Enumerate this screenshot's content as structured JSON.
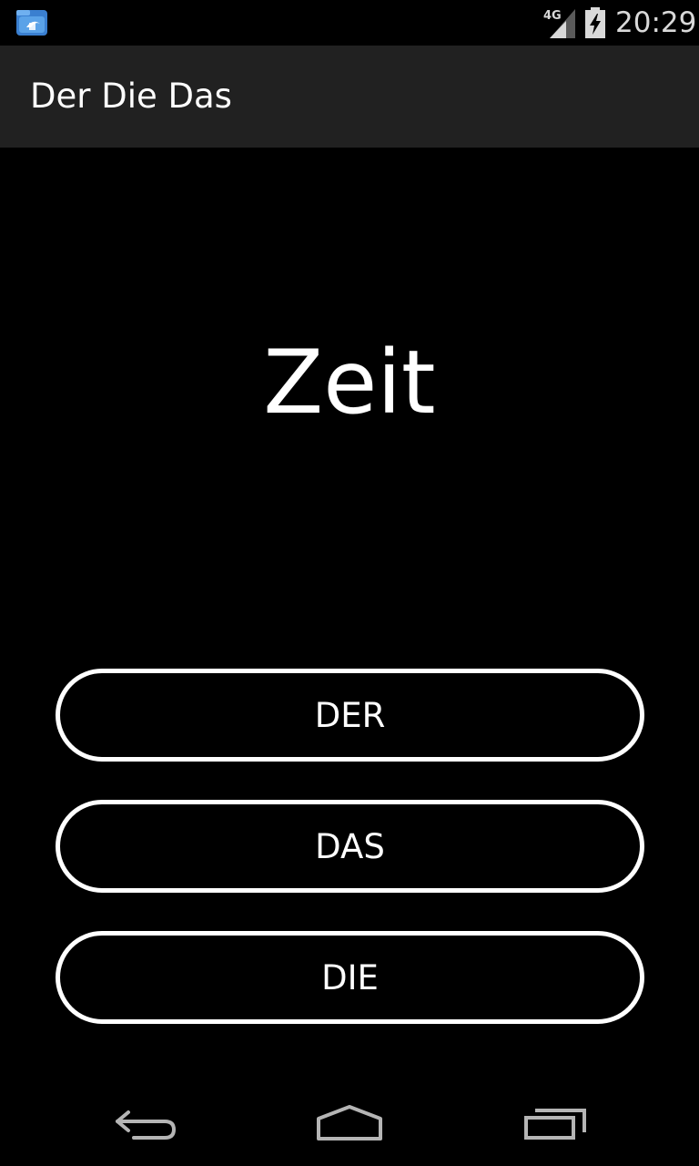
{
  "status_bar": {
    "time": "20:29",
    "network": "4G",
    "notification_icon": "file-manager-app-icon",
    "signal_icon": "signal-icon",
    "battery_icon": "battery-charging-icon"
  },
  "action_bar": {
    "title": "Der Die Das"
  },
  "quiz": {
    "word": "Zeit",
    "choices": [
      "DER",
      "DAS",
      "DIE"
    ]
  },
  "nav_bar": {
    "back_icon": "back-icon",
    "home_icon": "home-icon",
    "recents_icon": "recents-icon"
  },
  "colors": {
    "background": "#000000",
    "action_bar": "#212121",
    "text": "#ffffff",
    "button_border": "#ffffff",
    "nav_icon": "#b5b5b5"
  }
}
